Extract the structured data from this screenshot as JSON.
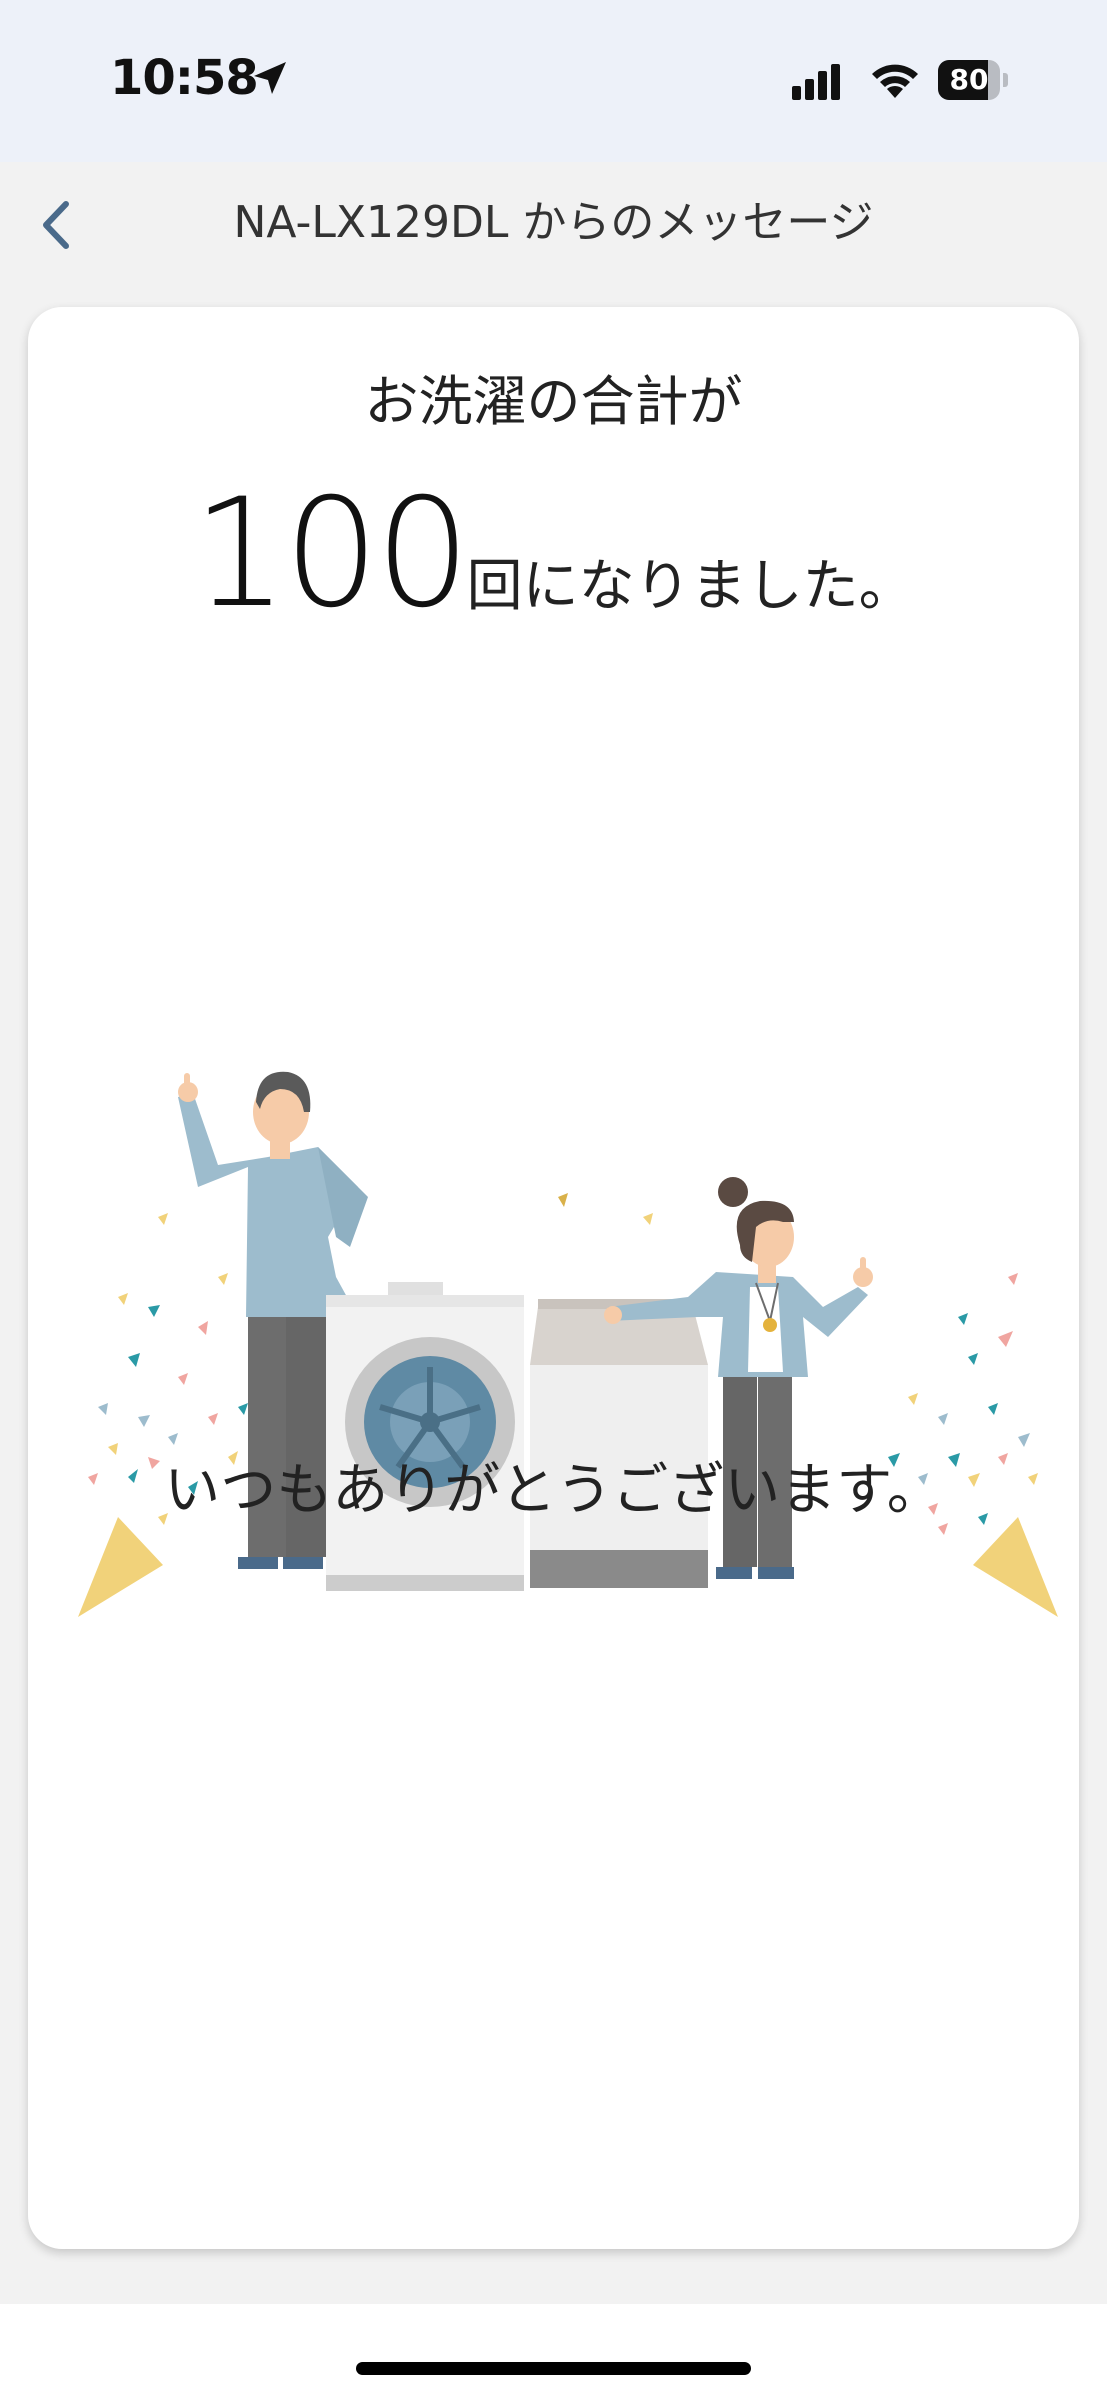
{
  "status_bar": {
    "time": "10:58",
    "battery_percent": "80",
    "battery_level": 0.8,
    "icons": [
      "location-arrow-icon",
      "cellular-signal-icon",
      "wifi-icon",
      "battery-icon"
    ]
  },
  "nav": {
    "title": "NA-LX129DL からのメッセージ",
    "back_icon": "chevron-left-icon",
    "accent": "#4a6a8a"
  },
  "message": {
    "headline": "お洗濯の合計が",
    "count": "100",
    "count_suffix": "回になりました。",
    "thanks": "いつもありがとうございます。"
  },
  "illustration": {
    "name": "celebration-laundry-illustration",
    "colors": {
      "shirt": "#9dbccd",
      "pants": "#6d6d6d",
      "skin": "#f6cba8",
      "hair": "#5a4a42",
      "confetti_cone": "#f1d27a",
      "washer_door": "#5f8aa4"
    }
  }
}
